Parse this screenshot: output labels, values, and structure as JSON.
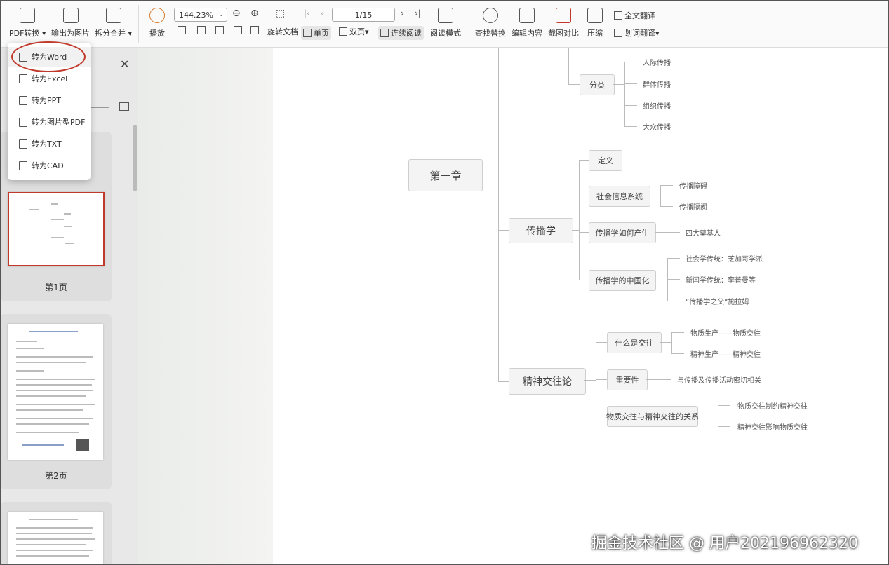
{
  "toolbar": {
    "pdf_convert": "PDF转换",
    "export_image": "输出为图片",
    "split_merge": "拆分合并",
    "play": "播放",
    "zoom": "144.23%",
    "page_indicator": "1/15",
    "rotate": "旋转文档",
    "single_page": "单页",
    "double_page": "双页",
    "continuous": "连续阅读",
    "read_mode": "阅读模式",
    "find_replace": "查找替换",
    "edit_content": "编辑内容",
    "screenshot_compare": "截图对比",
    "compress": "压缩",
    "full_translate": "全文翻译",
    "word_translate": "划词翻译"
  },
  "menu": {
    "items": [
      "转为Word",
      "转为Excel",
      "转为PPT",
      "转为图片型PDF",
      "转为TXT",
      "转为CAD"
    ]
  },
  "sidebar": {
    "pages": [
      "第1页",
      "第2页"
    ]
  },
  "mindmap": {
    "root": "第一章",
    "top_leaves": [
      "人际传播",
      "群体传播",
      "组织传播",
      "大众传播"
    ],
    "top_branch": "分类",
    "b1": "传播学",
    "b1_children": [
      "定义",
      "社会信息系统",
      "传播学如何产生",
      "传播学的中国化"
    ],
    "b1_social": [
      "传播障碍",
      "传播隔阂"
    ],
    "b1_origin": [
      "四大奠基人"
    ],
    "b1_china": [
      "社会学传统：芝加哥学派",
      "新闻学传统：李普曼等",
      "“传播学之父”施拉姆"
    ],
    "b2": "精神交往论",
    "b2_children": [
      "什么是交往",
      "重要性",
      "物质交往与精神交往的关系"
    ],
    "b2_what": [
      "物质生产——物质交往",
      "精神生产——精神交往"
    ],
    "b2_importance": [
      "与传播及传播活动密切相关"
    ],
    "b2_relation": [
      "物质交往制约精神交往",
      "精神交往影响物质交往"
    ]
  },
  "watermark": "掘金技术社区 @ 用户202196962320"
}
